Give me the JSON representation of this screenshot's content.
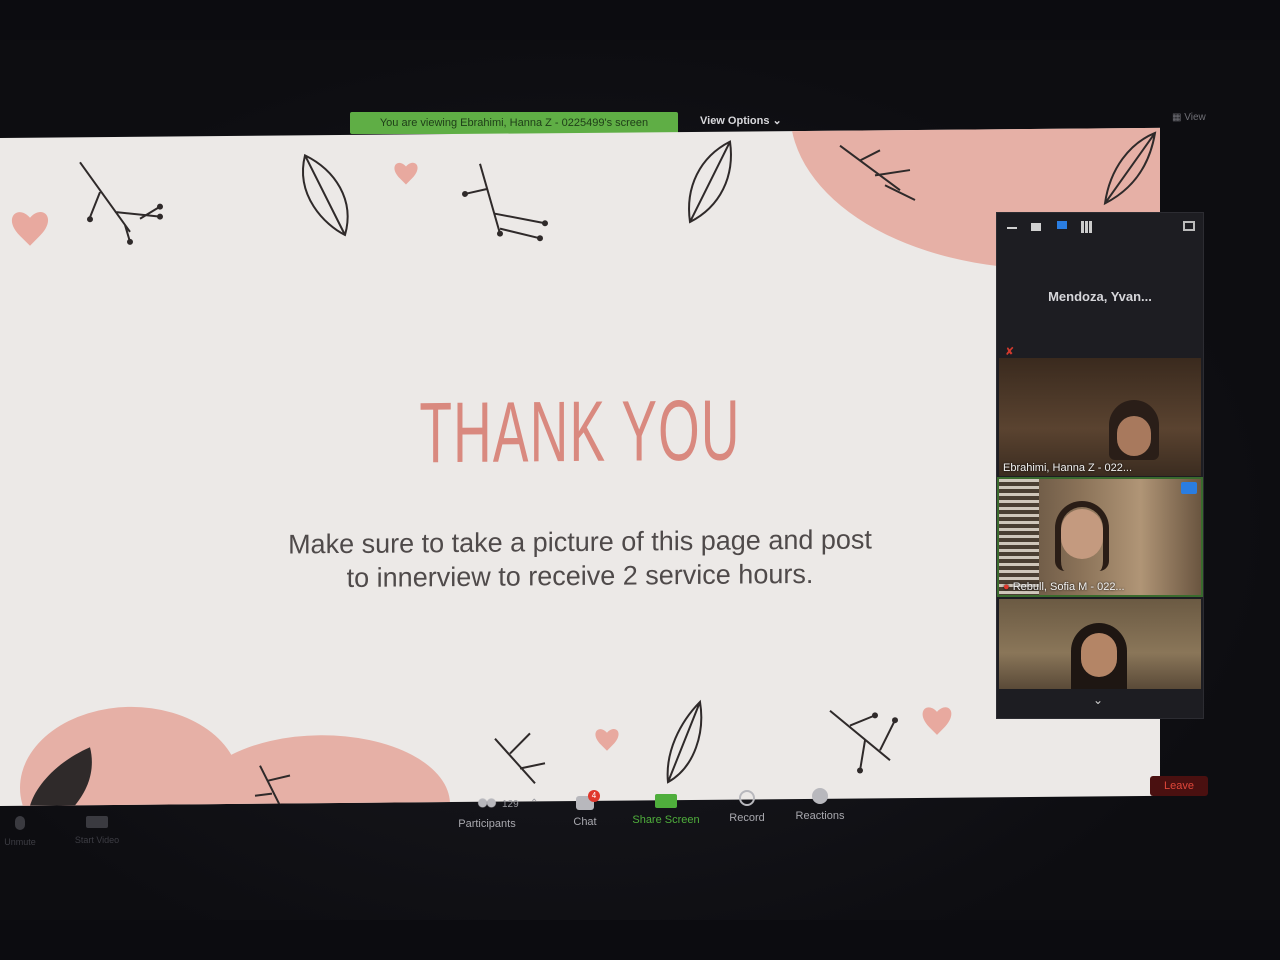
{
  "banner": {
    "viewing_text": "You are viewing Ebrahimi, Hanna Z - 0225499's screen",
    "view_options_label": "View Options",
    "view_label": "View"
  },
  "slide": {
    "title": "THANK YOU",
    "body_line1": "Make sure to take a picture of this page and post",
    "body_line2": "to innerview to receive 2 service hours."
  },
  "gallery": {
    "active_speaker": "Mendoza,  Yvan...",
    "tiles": [
      {
        "label": "Ebrahimi, Hanna Z - 022..."
      },
      {
        "label": "Rebull, Sofia M - 022..."
      },
      {
        "label": ""
      }
    ]
  },
  "toolbar": {
    "participants_label": "Participants",
    "participants_count": "129",
    "chat_label": "Chat",
    "chat_badge": "4",
    "share_label": "Share Screen",
    "record_label": "Record",
    "reactions_label": "Reactions",
    "leave_label": "Leave",
    "mute_label": "Unmute",
    "video_label": "Start Video"
  },
  "colors": {
    "accent_green": "#5fae45",
    "slide_pink": "#e6b0a6",
    "title_pink": "#d9897f",
    "leave_red": "#e0473a"
  }
}
